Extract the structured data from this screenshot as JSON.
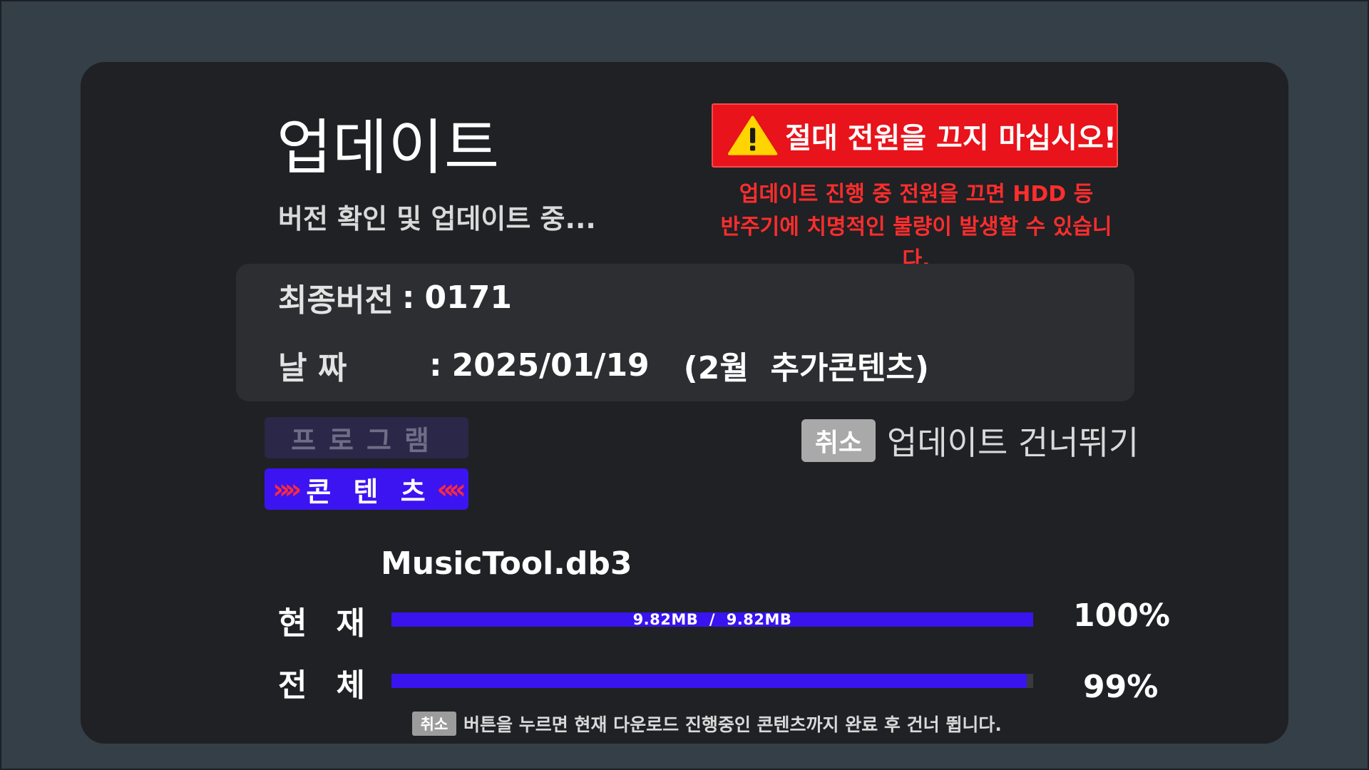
{
  "header": {
    "title": "업데이트",
    "subtitle": "버전 확인 및 업데이트 중..."
  },
  "warning": {
    "headline": "절대 전원을 끄지 마십시오!",
    "note_line1": "업데이트 진행 중 전원을 끄면 HDD 등",
    "note_line2": "반주기에 치명적인 불량이 발생할 수 있습니다.",
    "icon": "warning-triangle-icon"
  },
  "info": {
    "version_label": "최종버전",
    "version_value": "0171",
    "date_label_1": "날",
    "date_label_2": "짜",
    "separator": ":",
    "date_value": "2025/01/19",
    "date_extra": "(2월  추가콘텐츠)"
  },
  "tabs": {
    "program": "프로그램",
    "content": "콘 텐 츠"
  },
  "cancel": {
    "button_label": "취소",
    "skip_label": "업데이트 건너뛰기"
  },
  "progress": {
    "filename": "MusicTool.db3",
    "current_label_1": "현",
    "current_label_2": "재",
    "current_text": "9.82MB  /  9.82MB",
    "current_percent": "100%",
    "current_fraction": 1.0,
    "total_label_1": "전",
    "total_label_2": "체",
    "total_percent": "99%",
    "total_fraction": 0.99
  },
  "footer": {
    "button_label": "취소",
    "text": "버튼을 누르면 현재 다운로드 진행중인 콘텐츠까지 완료 후 건너 뜁니다."
  },
  "colors": {
    "background": "#353f47",
    "panel": "#1f2124",
    "warning_red": "#e8131b",
    "progress_blue": "#3a14ee",
    "tab_active": "#3c14f2"
  }
}
